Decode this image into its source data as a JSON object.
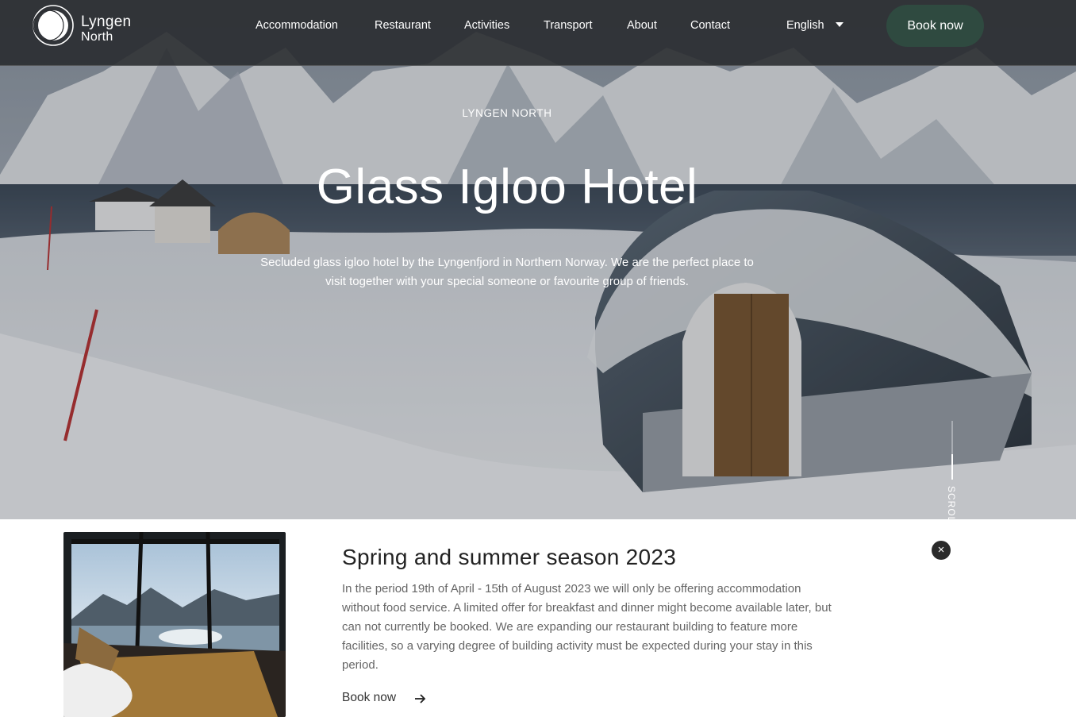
{
  "brand": {
    "line1": "Lyngen",
    "line2": "North"
  },
  "nav": {
    "items": [
      {
        "label": "Accommodation"
      },
      {
        "label": "Restaurant"
      },
      {
        "label": "Activities"
      },
      {
        "label": "Transport"
      },
      {
        "label": "About"
      },
      {
        "label": "Contact"
      }
    ],
    "language": "English",
    "book_label": "Book now"
  },
  "hero": {
    "eyebrow": "LYNGEN NORTH",
    "title": "Glass Igloo Hotel",
    "description": "Secluded glass igloo hotel by the Lyngenfjord in Northern Norway. We are the perfect place to visit together with your special someone or favourite group of friends.",
    "scroll_label": "SCROLL"
  },
  "notice": {
    "title": "Spring and summer season 2023",
    "body": "In the period 19th of April - 15th of August 2023 we will only be offering accommodation without food service. A limited offer for breakfast and dinner might become available later, but can not currently be booked. We are expanding our restaurant building to feature more facilities, so a varying degree of building activity must be expected during your stay in this period.",
    "link_label": "Book now",
    "close_glyph": "×"
  },
  "colors": {
    "accent": "#2f4a40",
    "header_bg": "#2a2c30"
  }
}
